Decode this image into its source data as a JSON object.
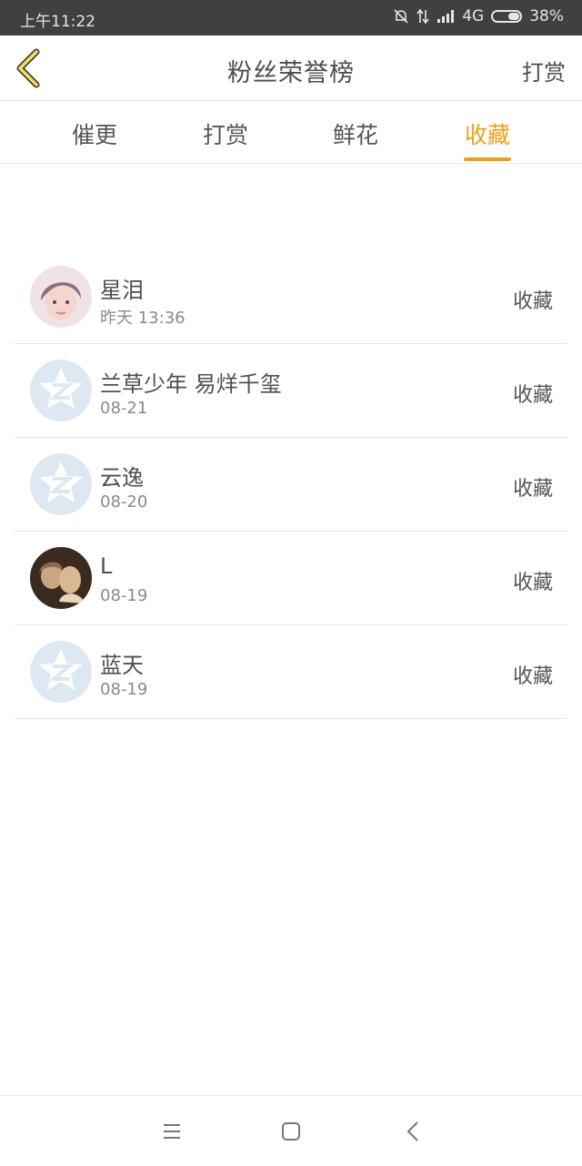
{
  "status": {
    "time": "上午11:22",
    "network": "4G",
    "battery": "38%"
  },
  "header": {
    "title": "粉丝荣誉榜",
    "action": "打赏"
  },
  "tabs": [
    {
      "label": "催更",
      "active": false
    },
    {
      "label": "打赏",
      "active": false
    },
    {
      "label": "鲜花",
      "active": false
    },
    {
      "label": "收藏",
      "active": true
    }
  ],
  "accent_color": "#f0a016",
  "rows": [
    {
      "name": "星泪",
      "date": "昨天 13:36",
      "type": "收藏",
      "avatar": "photo-portrait"
    },
    {
      "name": "兰草少年 易烊千玺",
      "date": "08-21",
      "type": "收藏",
      "avatar": "default-qzone-star"
    },
    {
      "name": "云逸",
      "date": "08-20",
      "type": "收藏",
      "avatar": "default-qzone-star"
    },
    {
      "name": "L",
      "date": "08-19",
      "type": "收藏",
      "avatar": "photo-sepia"
    },
    {
      "name": "蓝天",
      "date": "08-19",
      "type": "收藏",
      "avatar": "default-qzone-star"
    }
  ],
  "navbar": {
    "icons": [
      "menu-icon",
      "home-icon",
      "back-icon"
    ]
  }
}
